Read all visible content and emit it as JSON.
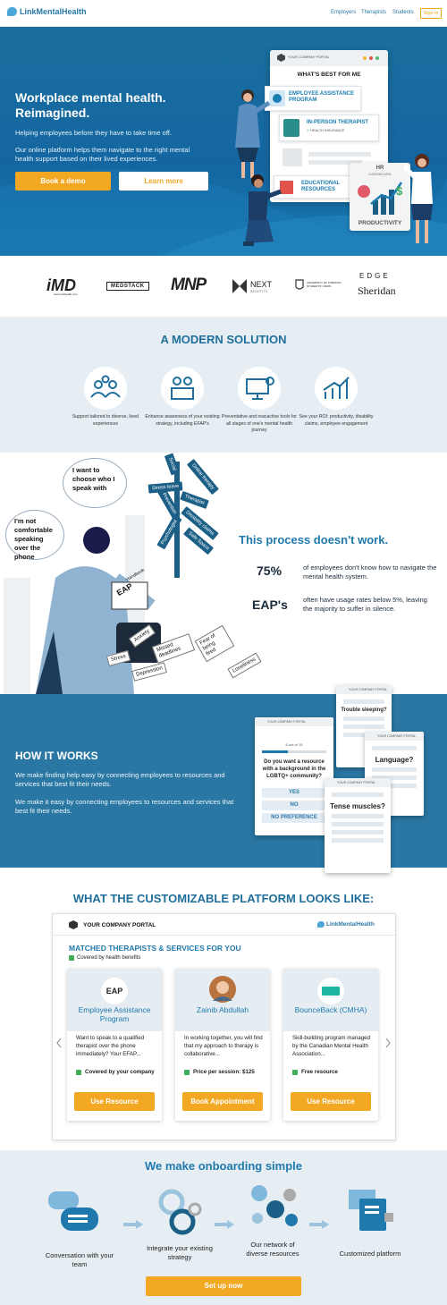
{
  "nav": {
    "brand": "LinkMentalHealth",
    "links": [
      "Employers",
      "Therapists",
      "Students"
    ],
    "signin": "Sign in"
  },
  "hero": {
    "title": "Workplace mental health. Reimagined.",
    "p1": "Helping employees before they have to take time off.",
    "p2": "Our online platform helps them navigate to the right mental health support based on their lived experiences.",
    "demo": "Book a demo",
    "learn": "Learn more",
    "portal": {
      "bar": "YOUR COMPANY PORTAL",
      "heading": "WHAT'S BEST FOR ME",
      "c1": "EMPLOYEE ASSISTANCE PROGRAM",
      "c2": "IN-PERSON THERAPIST",
      "c2sub": "HEALTH INSURANCE",
      "c3": "EDUCATIONAL RESOURCES"
    },
    "hr": {
      "top": "HR",
      "dash": "DASHBOARD",
      "label": "PRODUCTIVITY"
    },
    "colors": {
      "bg": "#1466a0",
      "accent": "#f3a824"
    }
  },
  "logos": {
    "imd": "iMD",
    "imdsub": "www.imdhealth.com",
    "medstack": "MEDSTACK",
    "mnp": "MNP",
    "next": "NEXT",
    "nextsub": "BENEFITS",
    "ut": "UNIVERSITY OF TORONTO STUDENTS' UNION",
    "edge": "EDGE",
    "sheridan": "Sheridan"
  },
  "modern": {
    "title": "A MODERN SOLUTION",
    "items": [
      "Support tailored to diverse, lived experiences",
      "Enhance awareness of your existing strategy, including EFAP's",
      "Preventative and reacactive tools for all stages of one's mental health journey",
      "See your ROI: productivity, disability claims, employee engagement"
    ]
  },
  "process": {
    "title": "This process doesn't work.",
    "stats": [
      {
        "num": "75%",
        "txt": "of employees don't know how to navigate the mental health system."
      },
      {
        "num": "EAP's",
        "txt": "often have usage rates below 5%, leaving the majority to suffer in silence."
      }
    ],
    "bubbles": [
      "I want to choose who I speak with",
      "I'm not comfortable speaking over the phone"
    ],
    "signs": [
      "Social",
      "Online therapy",
      "Stress leave",
      "Therapist",
      "Prevention",
      "Disability claims",
      "Psychologist",
      "Safe Space"
    ],
    "tags": [
      "Anxiety",
      "Missed deadlines",
      "Fear of being fired",
      "Stress",
      "Depression",
      "Loneliness"
    ],
    "book": "EAP",
    "handbook": "Handbook"
  },
  "how": {
    "title": "HOW IT WORKS",
    "p1": "We make finding help easy by connecting employees to resources and services that best fit their needs.",
    "p2": "We make it easy by connecting employees to resources and services that best fit their needs.",
    "mini": {
      "bar": "YOUR COMPANY PORTAL",
      "count": "6 out of 15",
      "q1": "Do you want a resource with a background in the LGBTQ+ community?",
      "opts": [
        "YES",
        "NO",
        "NO PREFERENCE"
      ],
      "q2": "Trouble sleeping?",
      "q3": "Language?",
      "q4": "Tense muscles?"
    }
  },
  "platform": {
    "title": "WHAT THE CUSTOMIZABLE PLATFORM LOOKS LIKE:",
    "bar": "YOUR COMPANY PORTAL",
    "brand": "LinkMentalHealth",
    "heading": "MATCHED THERAPISTS & SERVICES FOR YOU",
    "covered": "Covered by health benefits",
    "cards": [
      {
        "badge": "EAP",
        "name": "Employee Assistance Program",
        "desc": "Want to speak to a qualified therapist over the phone immediately? Your EFAP...",
        "meta": "Covered by your company",
        "btn": "Use Resource"
      },
      {
        "name": "Zainib Abdullah",
        "desc": "In working together, you will find that my approach to therapy is collaborative...",
        "meta": "Price per session: $125",
        "btn": "Book Appointment"
      },
      {
        "name": "BounceBack (CMHA)",
        "desc": "Skill-building program managed by the Canadian Mental Health Association...",
        "meta": "Free resource",
        "btn": "Use Resource"
      }
    ]
  },
  "onboarding": {
    "title": "We make onboarding simple",
    "steps": [
      "Conversation with your team",
      "Integrate your existing strategy",
      "Our network of diverse resources",
      "Customized platform"
    ],
    "cta": "Set up now"
  }
}
